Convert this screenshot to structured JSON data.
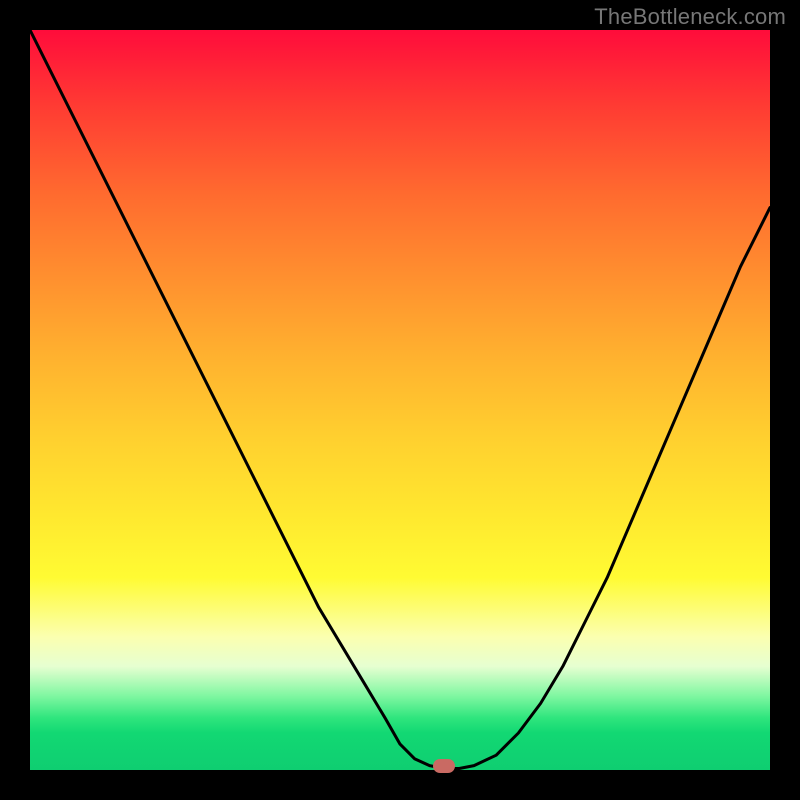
{
  "watermark": "TheBottleneck.com",
  "chart_data": {
    "type": "line",
    "title": "",
    "xlabel": "",
    "ylabel": "",
    "xlim": [
      0,
      100
    ],
    "ylim": [
      0,
      100
    ],
    "grid": false,
    "series": [
      {
        "name": "curve",
        "x": [
          0,
          3,
          6,
          9,
          12,
          15,
          18,
          21,
          24,
          27,
          30,
          33,
          36,
          39,
          42,
          45,
          48,
          50,
          52,
          54,
          56,
          58,
          60,
          63,
          66,
          69,
          72,
          75,
          78,
          81,
          84,
          87,
          90,
          93,
          96,
          100
        ],
        "values": [
          100,
          94,
          88,
          82,
          76,
          70,
          64,
          58,
          52,
          46,
          40,
          34,
          28,
          22,
          17,
          12,
          7,
          3.5,
          1.5,
          0.6,
          0.2,
          0.2,
          0.6,
          2,
          5,
          9,
          14,
          20,
          26,
          33,
          40,
          47,
          54,
          61,
          68,
          76
        ]
      }
    ],
    "marker": {
      "x": 56,
      "y": 0.5
    },
    "background_gradient": {
      "top_color": "#ff0c3b",
      "bottom_color": "#0fce71"
    }
  }
}
